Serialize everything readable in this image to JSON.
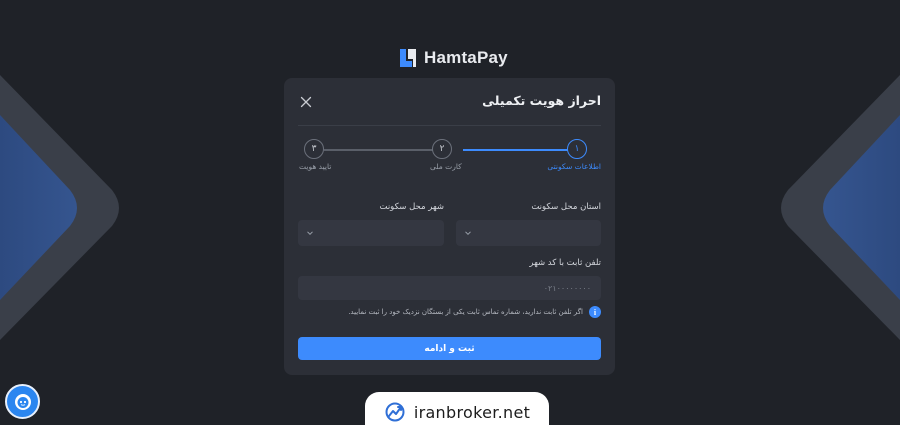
{
  "brand": {
    "name": "HamtaPay"
  },
  "dialog": {
    "title": "احراز هویت تکمیلی",
    "close_icon": "close-icon"
  },
  "stepper": {
    "steps": [
      {
        "number": "۱",
        "label": "اطلاعات سکونتی",
        "state": "active"
      },
      {
        "number": "۲",
        "label": "کارت ملی",
        "state": "pending"
      },
      {
        "number": "۳",
        "label": "تایید هویت",
        "state": "pending"
      }
    ]
  },
  "form": {
    "province": {
      "label": "استان محل سکونت",
      "value": ""
    },
    "city": {
      "label": "شهر محل سکونت",
      "value": ""
    },
    "phone": {
      "label": "تلفن ثابت با کد شهر",
      "placeholder": "۰۲۱۰۰۰۰۰۰۰۰",
      "value": ""
    },
    "info_text": "اگر تلفن ثابت ندارید، شماره تماس ثابت یکی از بستگان نزدیک خود را ثبت نمایید.",
    "submit_label": "ثبت و ادامه"
  },
  "watermark": {
    "text": "iranbroker.net"
  },
  "colors": {
    "background": "#1f2228",
    "card": "#2c2f37",
    "accent": "#3d8bfd",
    "input": "#343741"
  }
}
